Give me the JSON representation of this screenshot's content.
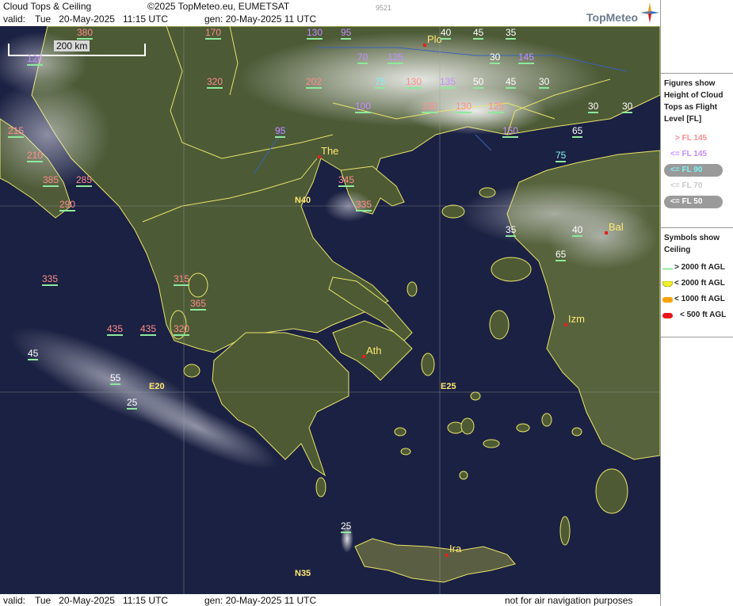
{
  "header": {
    "title": "Cloud Tops & Ceiling",
    "copyright": "©2025 TopMeteo.eu, EUMETSAT",
    "code": "9521",
    "valid_label": "valid:",
    "valid_value": "Tue   20-May-2025   11:15 UTC",
    "gen": "gen: 20-May-2025 11 UTC",
    "brand": "TopMeteo"
  },
  "footer": {
    "valid_label": "valid:",
    "valid_value": "Tue   20-May-2025   11:15 UTC",
    "gen": "gen: 20-May-2025 11 UTC",
    "disclaimer": "not for air navigation purposes"
  },
  "legend": {
    "heading_tops": "Figures show Height of Cloud Tops as Flight Level  [FL]",
    "tops": [
      {
        "label": "> FL 145",
        "color": "#ff8c8c",
        "oval": false
      },
      {
        "label": "<= FL 145",
        "color": "#c48cff",
        "oval": false
      },
      {
        "label": "<= FL 90",
        "color": "#7ff2f2",
        "oval": true
      },
      {
        "label": "<= FL 70",
        "color": "#c8c8c8",
        "oval": false
      },
      {
        "label": "<= FL 50",
        "color": "#ffffff",
        "oval": true
      }
    ],
    "heading_ceiling": "Symbols show Ceiling",
    "ceiling": [
      {
        "label": "> 2000 ft AGL",
        "color": "#8ee99d"
      },
      {
        "label": "< 2000 ft AGL",
        "color": "#f2ef2b"
      },
      {
        "label": "< 1000 ft AGL",
        "color": "#f5a300"
      },
      {
        "label": "< 500 ft AGL",
        "color": "#e8161b"
      }
    ]
  },
  "map": {
    "scale_label": "200 km",
    "grid": {
      "lat1": "N40",
      "lat2": "N35",
      "lon1": "E20",
      "lon2": "E25"
    },
    "cities": {
      "the": "The",
      "ath": "Ath",
      "plo": "Plo",
      "izm": "Izm",
      "bal": "Bal",
      "ira": "Ira"
    },
    "figures": [
      "380",
      "170",
      "130",
      "95",
      "40",
      "45",
      "35",
      "120",
      "70",
      "125",
      "30",
      "145",
      "320",
      "202",
      "75",
      "130",
      "135",
      "50",
      "45",
      "30",
      "100",
      "130",
      "130",
      "125",
      "30",
      "30",
      "95",
      "150",
      "65",
      "215",
      "210",
      "75",
      "385",
      "285",
      "345",
      "290",
      "335",
      "35",
      "40",
      "65",
      "335",
      "315",
      "365",
      "435",
      "435",
      "320",
      "45",
      "55",
      "25",
      "25"
    ]
  }
}
